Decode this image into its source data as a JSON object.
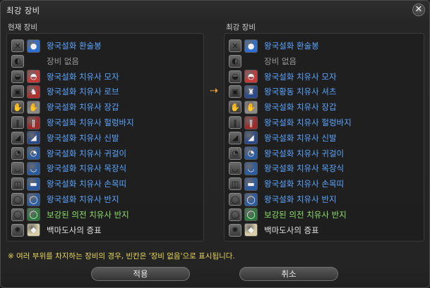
{
  "window": {
    "title": "최강 장비",
    "close_glyph": "✕"
  },
  "current": {
    "header": "현재 장비",
    "rows": [
      {
        "slot_icon": "weapon-icon",
        "slot_glyph": "✕",
        "item_icon": "staff-icon",
        "item_glyph": "●",
        "item_color": "#2d6fd1",
        "name": "왕국설화 환술봉",
        "name_class": "blue"
      },
      {
        "slot_icon": "shield-icon",
        "slot_glyph": "◐",
        "item_icon": "empty-icon",
        "item_glyph": "",
        "item_color": "",
        "name": "장비 없음",
        "name_class": "gray"
      },
      {
        "slot_icon": "head-icon",
        "slot_glyph": "◒",
        "item_icon": "hat-icon",
        "item_glyph": "◓",
        "item_color": "#c43a3a",
        "name": "왕국설화 치유사 모자",
        "name_class": "blue"
      },
      {
        "slot_icon": "body-icon",
        "slot_glyph": "▣",
        "item_icon": "robe-icon",
        "item_glyph": "♞",
        "item_color": "#b03030",
        "name": "왕국설화 치유사 로브",
        "name_class": "blue"
      },
      {
        "slot_icon": "hands-icon",
        "slot_glyph": "✋",
        "item_icon": "gloves-icon",
        "item_glyph": "✋",
        "item_color": "#8a8a8a",
        "name": "왕국설화 치유사 장갑",
        "name_class": "blue"
      },
      {
        "slot_icon": "legs-icon",
        "slot_glyph": "‖",
        "item_icon": "pants-icon",
        "item_glyph": "‖",
        "item_color": "#a02828",
        "name": "왕국설화 치유사 헐렁바지",
        "name_class": "blue"
      },
      {
        "slot_icon": "feet-icon",
        "slot_glyph": "◢",
        "item_icon": "boots-icon",
        "item_glyph": "◢",
        "item_color": "#2a4a8a",
        "name": "왕국설화 치유사 신발",
        "name_class": "blue"
      },
      {
        "slot_icon": "ear-icon",
        "slot_glyph": "◔",
        "item_icon": "earring-icon",
        "item_glyph": "◔",
        "item_color": "#2a5aa0",
        "name": "왕국설화 치유사 귀걸이",
        "name_class": "blue"
      },
      {
        "slot_icon": "neck-icon",
        "slot_glyph": "◡",
        "item_icon": "necklace-icon",
        "item_glyph": "◡",
        "item_color": "#2a5aa0",
        "name": "왕국설화 치유사 목장식",
        "name_class": "blue"
      },
      {
        "slot_icon": "wrist-icon",
        "slot_glyph": "◫",
        "item_icon": "bracelet-icon",
        "item_glyph": "▬",
        "item_color": "#2a5aa0",
        "name": "왕국설화 치유사 손목띠",
        "name_class": "blue"
      },
      {
        "slot_icon": "ring-icon",
        "slot_glyph": "◯",
        "item_icon": "ring-item-icon",
        "item_glyph": "◯",
        "item_color": "#2a5aa0",
        "name": "왕국설화 치유사 반지",
        "name_class": "blue"
      },
      {
        "slot_icon": "ring-icon",
        "slot_glyph": "◯",
        "item_icon": "ring-item-icon",
        "item_glyph": "◯",
        "item_color": "#2b7a3a",
        "name": "보강된 의전 치유사 반지",
        "name_class": "green"
      },
      {
        "slot_icon": "soul-crystal-slot-icon",
        "slot_glyph": "✺",
        "item_icon": "soul-crystal-icon",
        "item_glyph": "◆",
        "item_color": "#d8cfa8",
        "name": "백마도사의 증표",
        "name_class": "white"
      }
    ]
  },
  "best": {
    "header": "최강 장비",
    "rows": [
      {
        "slot_icon": "weapon-icon",
        "slot_glyph": "✕",
        "item_icon": "staff-icon",
        "item_glyph": "●",
        "item_color": "#2d6fd1",
        "name": "왕국설화 환술봉",
        "name_class": "blue"
      },
      {
        "slot_icon": "shield-icon",
        "slot_glyph": "◐",
        "item_icon": "empty-icon",
        "item_glyph": "",
        "item_color": "",
        "name": "장비 없음",
        "name_class": "gray"
      },
      {
        "slot_icon": "head-icon",
        "slot_glyph": "◒",
        "item_icon": "hat-icon",
        "item_glyph": "◓",
        "item_color": "#c43a3a",
        "name": "왕국설화 치유사 모자",
        "name_class": "blue"
      },
      {
        "slot_icon": "body-icon",
        "slot_glyph": "▣",
        "item_icon": "shirt-icon",
        "item_glyph": "♜",
        "item_color": "#2a4a8a",
        "name": "왕국황동 치유사 셔츠",
        "name_class": "blue"
      },
      {
        "slot_icon": "hands-icon",
        "slot_glyph": "✋",
        "item_icon": "gloves-icon",
        "item_glyph": "✋",
        "item_color": "#8a8a8a",
        "name": "왕국설화 치유사 장갑",
        "name_class": "blue"
      },
      {
        "slot_icon": "legs-icon",
        "slot_glyph": "‖",
        "item_icon": "pants-icon",
        "item_glyph": "‖",
        "item_color": "#a02828",
        "name": "왕국설화 치유사 헐렁바지",
        "name_class": "blue"
      },
      {
        "slot_icon": "feet-icon",
        "slot_glyph": "◢",
        "item_icon": "boots-icon",
        "item_glyph": "◢",
        "item_color": "#2a4a8a",
        "name": "왕국설화 치유사 신발",
        "name_class": "blue"
      },
      {
        "slot_icon": "ear-icon",
        "slot_glyph": "◔",
        "item_icon": "earring-icon",
        "item_glyph": "◔",
        "item_color": "#2a5aa0",
        "name": "왕국설화 치유사 귀걸이",
        "name_class": "blue"
      },
      {
        "slot_icon": "neck-icon",
        "slot_glyph": "◡",
        "item_icon": "necklace-icon",
        "item_glyph": "◡",
        "item_color": "#2a5aa0",
        "name": "왕국설화 치유사 목장식",
        "name_class": "blue"
      },
      {
        "slot_icon": "wrist-icon",
        "slot_glyph": "◫",
        "item_icon": "bracelet-icon",
        "item_glyph": "▬",
        "item_color": "#2a5aa0",
        "name": "왕국설화 치유사 손목띠",
        "name_class": "blue"
      },
      {
        "slot_icon": "ring-icon",
        "slot_glyph": "◯",
        "item_icon": "ring-item-icon",
        "item_glyph": "◯",
        "item_color": "#2a5aa0",
        "name": "왕국설화 치유사 반지",
        "name_class": "blue"
      },
      {
        "slot_icon": "ring-icon",
        "slot_glyph": "◯",
        "item_icon": "ring-item-icon",
        "item_glyph": "◯",
        "item_color": "#2b7a3a",
        "name": "보강된 의전 치유사 반지",
        "name_class": "green"
      },
      {
        "slot_icon": "soul-crystal-slot-icon",
        "slot_glyph": "✺",
        "item_icon": "soul-crystal-icon",
        "item_glyph": "◆",
        "item_color": "#d8cfa8",
        "name": "백마도사의 증표",
        "name_class": "white"
      }
    ]
  },
  "change_arrow": "⇢",
  "notice": "※ 여러 부위를 차지하는 장비의 경우, 빈칸은 '장비 없음'으로 표시됩니다.",
  "buttons": {
    "apply": "적용",
    "cancel": "취소"
  }
}
